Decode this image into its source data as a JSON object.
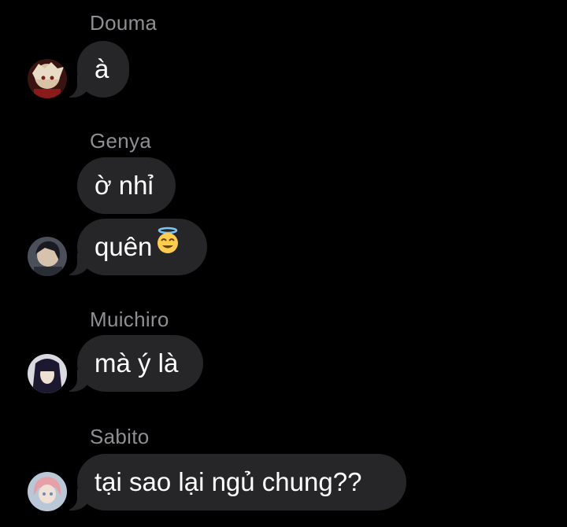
{
  "messages": [
    {
      "sender": "Douma",
      "bubbles": [
        "à"
      ],
      "avatar": "douma-avatar"
    },
    {
      "sender": "Genya",
      "bubbles": [
        "ờ nhỉ",
        "quên"
      ],
      "emoji": "smiling-face-with-halo",
      "avatar": "genya-avatar"
    },
    {
      "sender": "Muichiro",
      "bubbles": [
        "mà ý là"
      ],
      "avatar": "muichiro-avatar"
    },
    {
      "sender": "Sabito",
      "bubbles": [
        "tại sao lại ngủ chung??"
      ],
      "avatar": "sabito-avatar"
    }
  ],
  "colors": {
    "background": "#000000",
    "bubble": "#262629",
    "sender": "#8e8e93",
    "text": "#ffffff"
  }
}
